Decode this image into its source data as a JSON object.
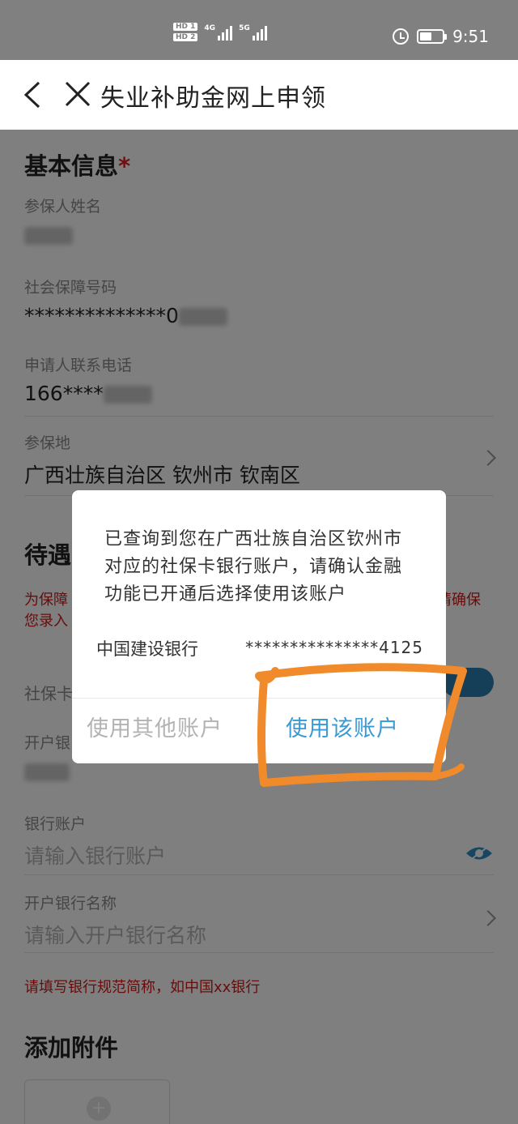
{
  "status_bar": {
    "hd1": "HD 1",
    "hd2": "HD 2",
    "net1": "4G",
    "net2": "5G",
    "time": "9:51",
    "icons": [
      "alarm-icon",
      "battery-icon",
      "signal-icon"
    ]
  },
  "navbar": {
    "title": "失业补助金网上申领",
    "back_icon": "chevron-left-icon",
    "close_icon": "close-icon"
  },
  "basic_info": {
    "title": "基本信息",
    "required_mark": "*",
    "name_label": "参保人姓名",
    "ssn_label": "社会保障号码",
    "ssn_value": "**************0",
    "phone_label": "申请人联系电话",
    "phone_value": "166****",
    "location_label": "参保地",
    "location_value": "广西壮族自治区 钦州市 钦南区"
  },
  "benefit": {
    "title_partial": "待遇",
    "warn_line1": "为保障",
    "warn_line1_end": "请确保",
    "warn_line2": "您录入",
    "social_card_label": "社保卡",
    "bank_open_label": "开户银"
  },
  "bank": {
    "account_label": "银行账户",
    "account_placeholder": "请输入银行账户",
    "bank_name_label": "开户银行名称",
    "bank_name_placeholder": "请输入开户银行名称",
    "bank_hint": "请填写银行规范简称，如中国xx银行"
  },
  "attachments": {
    "title": "添加附件"
  },
  "dialog": {
    "message": "已查询到您在广西壮族自治区钦州市对应的社保卡银行账户，请确认金融功能已开通后选择使用该账户",
    "bank_name": "中国建设银行",
    "account_masked": "***************4125",
    "btn_other": "使用其他账户",
    "btn_use": "使用该账户"
  },
  "colors": {
    "accent": "#3a9ad4",
    "warning": "#d01818",
    "highlight_stroke": "#f08a2a",
    "mask": "rgba(0,0,0,0.5)"
  }
}
